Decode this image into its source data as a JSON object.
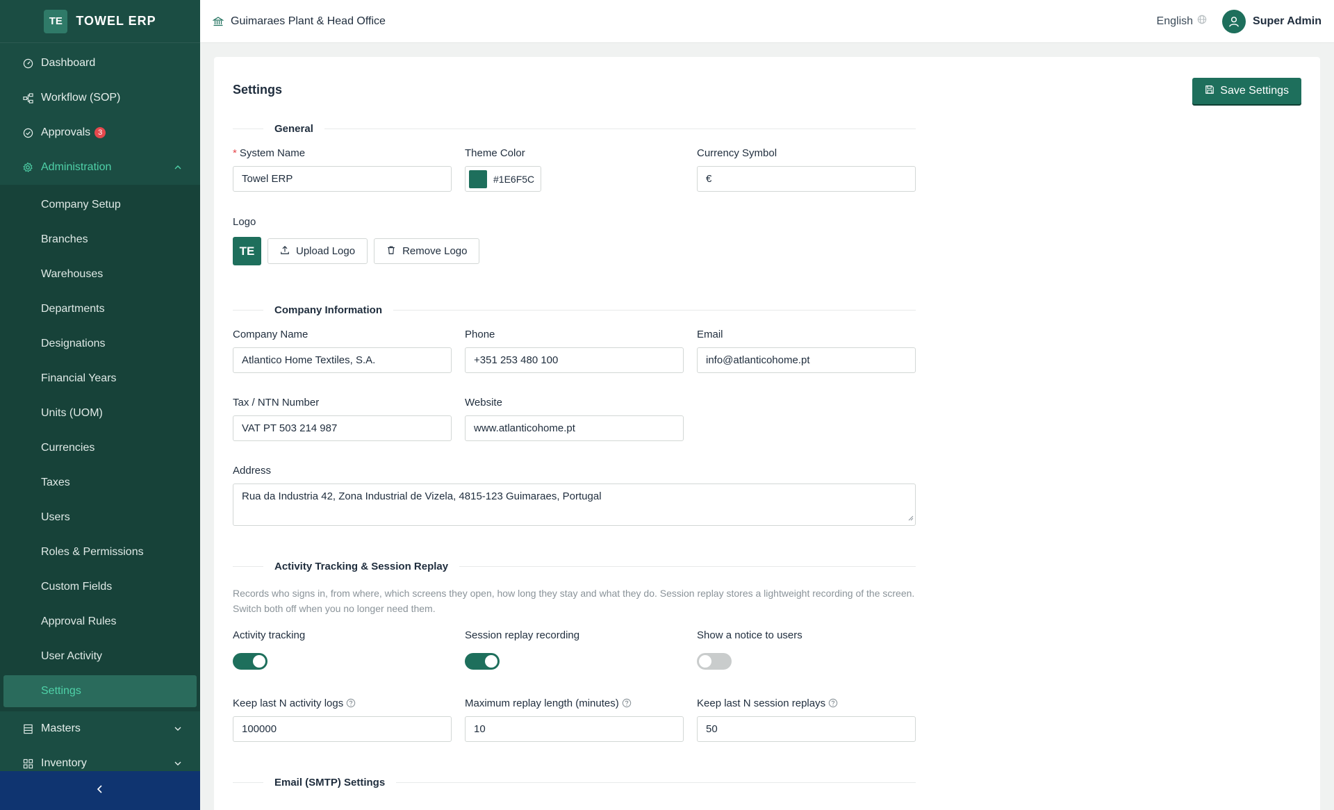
{
  "brand": {
    "logo_text": "TE",
    "name": "TOWEL ERP"
  },
  "sidebar": {
    "top_items": [
      {
        "label": "Dashboard",
        "icon": "dashboard-icon"
      },
      {
        "label": "Workflow (SOP)",
        "icon": "workflow-icon"
      },
      {
        "label": "Approvals",
        "icon": "check-circle-icon",
        "badge": "3"
      }
    ],
    "admin_group": {
      "label": "Administration",
      "icon": "gear-icon",
      "expanded": true
    },
    "admin_items": [
      {
        "label": "Company Setup"
      },
      {
        "label": "Branches"
      },
      {
        "label": "Warehouses"
      },
      {
        "label": "Departments"
      },
      {
        "label": "Designations"
      },
      {
        "label": "Financial Years"
      },
      {
        "label": "Units (UOM)"
      },
      {
        "label": "Currencies"
      },
      {
        "label": "Taxes"
      },
      {
        "label": "Users"
      },
      {
        "label": "Roles & Permissions"
      },
      {
        "label": "Custom Fields"
      },
      {
        "label": "Approval Rules"
      },
      {
        "label": "User Activity"
      },
      {
        "label": "Settings",
        "active": true
      }
    ],
    "bottom_items": [
      {
        "label": "Masters",
        "icon": "list-icon"
      },
      {
        "label": "Inventory",
        "icon": "grid-icon"
      }
    ]
  },
  "header": {
    "branch": "Guimaraes Plant & Head Office",
    "language": "English",
    "user": "Super Admin"
  },
  "page": {
    "title": "Settings",
    "save_label": "Save Settings"
  },
  "general": {
    "section_title": "General",
    "system_name_label": "System Name",
    "system_name_value": "Towel ERP",
    "theme_color_label": "Theme Color",
    "theme_color_value": "#1E6F5C",
    "currency_label": "Currency Symbol",
    "currency_value": "€",
    "logo_label": "Logo",
    "logo_text": "TE",
    "upload_label": "Upload Logo",
    "remove_label": "Remove Logo"
  },
  "company": {
    "section_title": "Company Information",
    "name_label": "Company Name",
    "name_value": "Atlantico Home Textiles, S.A.",
    "phone_label": "Phone",
    "phone_value": "+351 253 480 100",
    "email_label": "Email",
    "email_value": "info@atlanticohome.pt",
    "tax_label": "Tax / NTN Number",
    "tax_value": "VAT PT 503 214 987",
    "website_label": "Website",
    "website_value": "www.atlanticohome.pt",
    "address_label": "Address",
    "address_value": "Rua da Industria 42, Zona Industrial de Vizela, 4815-123 Guimaraes, Portugal"
  },
  "tracking": {
    "section_title": "Activity Tracking & Session Replay",
    "description": "Records who signs in, from where, which screens they open, how long they stay and what they do. Session replay stores a lightweight recording of the screen. Switch both off when you no longer need them.",
    "activity_label": "Activity tracking",
    "activity_on": true,
    "replay_label": "Session replay recording",
    "replay_on": true,
    "notice_label": "Show a notice to users",
    "notice_on": false,
    "keep_logs_label": "Keep last N activity logs",
    "keep_logs_value": "100000",
    "max_replay_label": "Maximum replay length (minutes)",
    "max_replay_value": "10",
    "keep_replays_label": "Keep last N session replays",
    "keep_replays_value": "50"
  },
  "smtp": {
    "section_title": "Email (SMTP) Settings"
  },
  "colors": {
    "sidebar": "#1b4d43",
    "accent": "#1e6f5c",
    "active_text": "#4fd1a8",
    "badge": "#e5484d"
  }
}
